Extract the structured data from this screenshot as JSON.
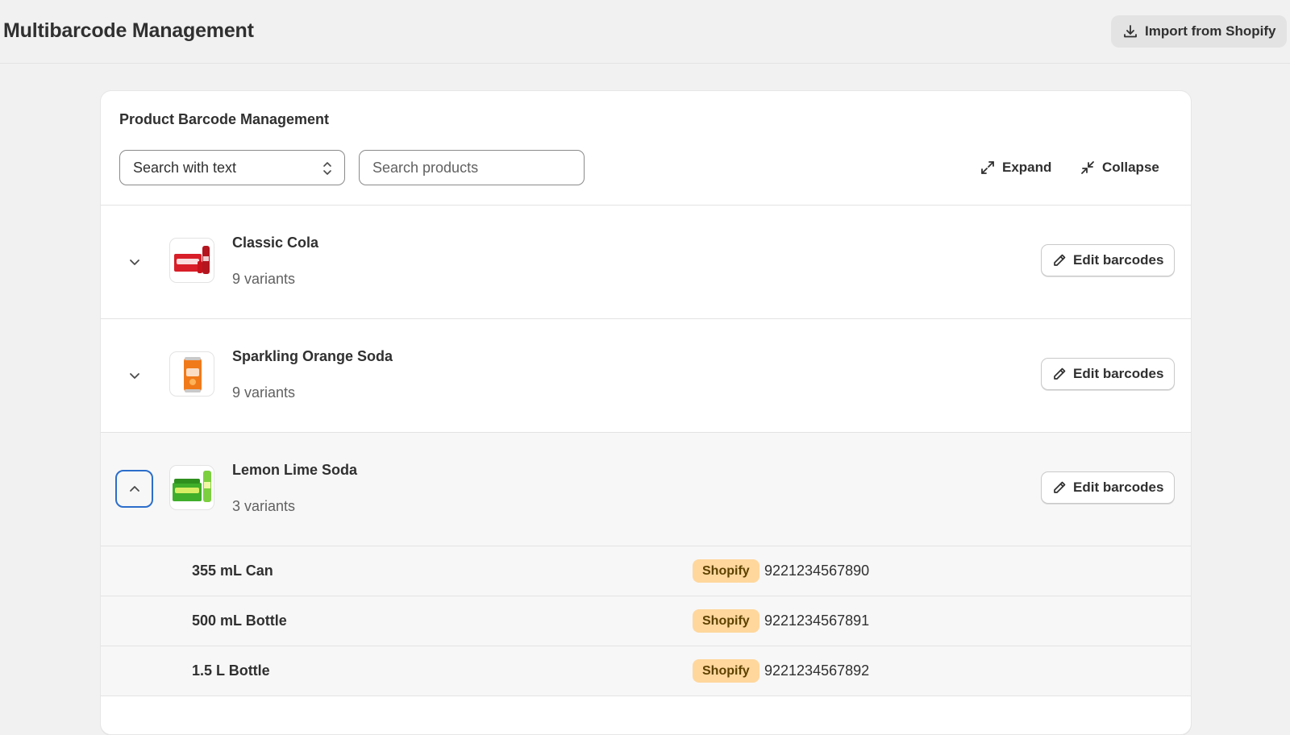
{
  "header": {
    "title": "Multibarcode Management",
    "import_label": "Import from Shopify",
    "import_icon": "download-icon"
  },
  "card": {
    "title": "Product Barcode Management",
    "search_mode": "Search with text",
    "search_placeholder": "Search products",
    "expand_label": "Expand",
    "collapse_label": "Collapse",
    "edit_label": "Edit barcodes"
  },
  "products": [
    {
      "name": "Classic Cola",
      "variants_text": "9 variants",
      "expanded": false,
      "thumb_colors": [
        "#d81e28",
        "#ffffff"
      ]
    },
    {
      "name": "Sparkling Orange Soda",
      "variants_text": "9 variants",
      "expanded": false,
      "thumb_colors": [
        "#f07a1a",
        "#ffffff"
      ]
    },
    {
      "name": "Lemon Lime Soda",
      "variants_text": "3 variants",
      "expanded": true,
      "thumb_colors": [
        "#3fae2a",
        "#ffffff"
      ]
    }
  ],
  "variants": [
    {
      "name": "355 mL Can",
      "source": "Shopify",
      "barcode": "9221234567890"
    },
    {
      "name": "500 mL Bottle",
      "source": "Shopify",
      "barcode": "9221234567891"
    },
    {
      "name": "1.5 L Bottle",
      "source": "Shopify",
      "barcode": "9221234567892"
    }
  ],
  "colors": {
    "focus_ring": "#2c6ecb",
    "badge_bg": "#ffd79d",
    "badge_text": "#5e4200",
    "page_bg": "#f1f1f1"
  }
}
